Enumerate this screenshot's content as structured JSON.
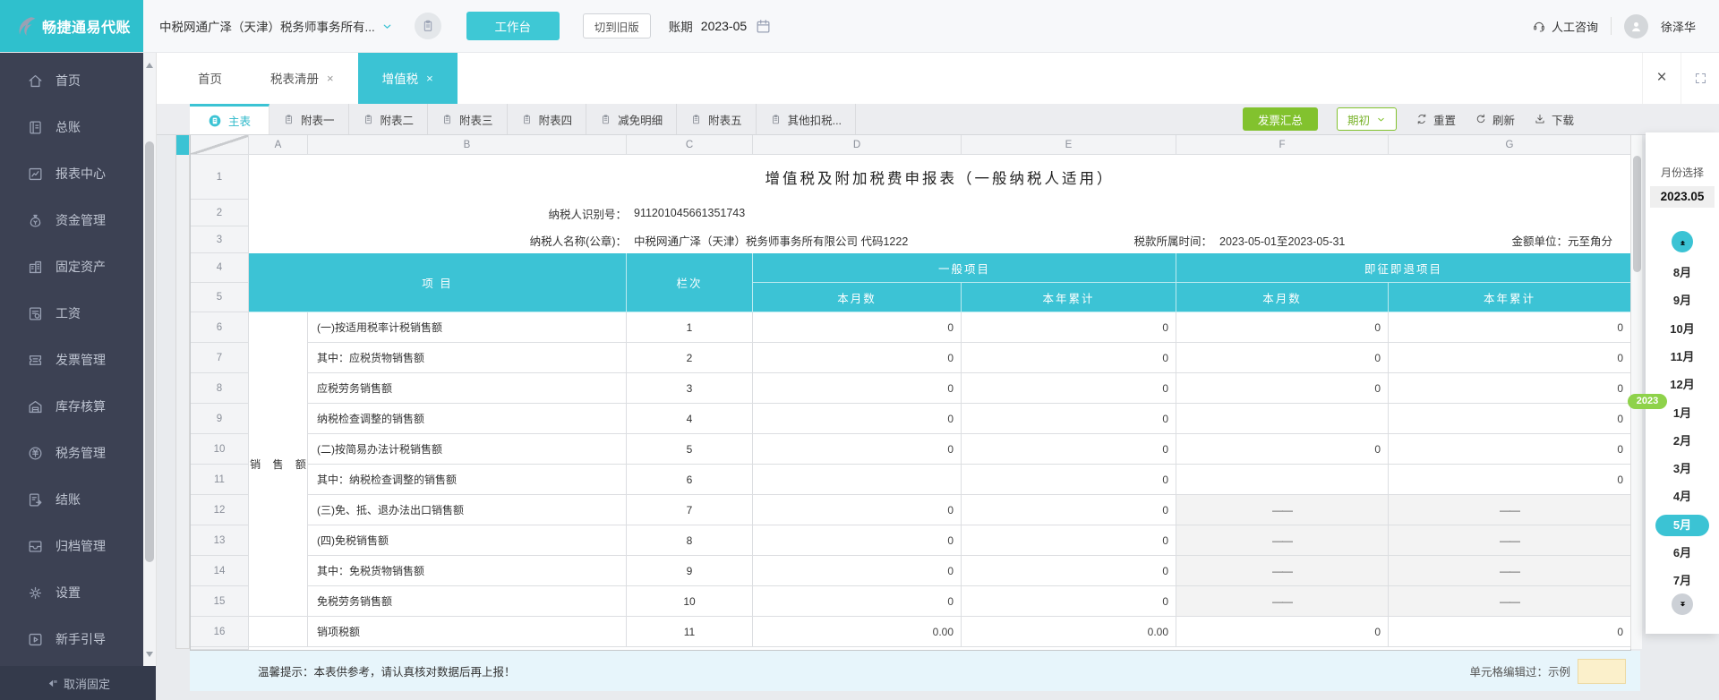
{
  "colors": {
    "teal": "#3bc3d4",
    "green": "#82c22e",
    "table_header": "#3cc3d5",
    "sidebar_bg": "#3c4153",
    "year_badge": "#8ed24a",
    "edited_cell": "#fbf0cb"
  },
  "brand": {
    "name": "畅捷通易代账"
  },
  "header": {
    "company": "中税网通广泽（天津）税务师事务所有...",
    "workbench": "工作台",
    "switch_old": "切到旧版",
    "period_label": "账期",
    "period_value": "2023-05",
    "support": "人工咨询",
    "user": "徐泽华"
  },
  "sidebar": {
    "items": [
      {
        "id": "home",
        "label": "首页"
      },
      {
        "id": "ledger",
        "label": "总账"
      },
      {
        "id": "report",
        "label": "报表中心"
      },
      {
        "id": "funds",
        "label": "资金管理"
      },
      {
        "id": "assets",
        "label": "固定资产"
      },
      {
        "id": "salary",
        "label": "工资"
      },
      {
        "id": "invoice",
        "label": "发票管理"
      },
      {
        "id": "inventory",
        "label": "库存核算"
      },
      {
        "id": "tax",
        "label": "税务管理"
      },
      {
        "id": "closing",
        "label": "结账"
      },
      {
        "id": "archive",
        "label": "归档管理"
      },
      {
        "id": "settings",
        "label": "设置"
      },
      {
        "id": "guide",
        "label": "新手引导"
      }
    ],
    "unpin": "取消固定"
  },
  "tabs": [
    {
      "label": "首页",
      "closable": false,
      "active": false
    },
    {
      "label": "税表清册",
      "closable": true,
      "active": false
    },
    {
      "label": "增值税",
      "closable": true,
      "active": true
    }
  ],
  "subtabs": [
    "主表",
    "附表一",
    "附表二",
    "附表三",
    "附表四",
    "减免明细",
    "附表五",
    "其他扣税..."
  ],
  "toolbar": {
    "invoice_summary": "发票汇总",
    "period_begin": "期初",
    "reset": "重置",
    "refresh": "刷新",
    "download": "下载"
  },
  "sheet": {
    "col_letters": [
      "A",
      "B",
      "C",
      "D",
      "E",
      "F",
      "G"
    ],
    "title": "增值税及附加税费申报表（一般纳税人适用）",
    "taxpayer_id_label": "纳税人识别号：",
    "taxpayer_id": "911201045661351743",
    "taxpayer_name_label": "纳税人名称(公章)：",
    "taxpayer_name": "中税网通广泽（天津）税务师事务所有限公司 代码1222",
    "tax_period_label": "税款所属时间：",
    "tax_period": "2023-05-01至2023-05-31",
    "unit_label": "金额单位：元至角分",
    "head": {
      "item": "项 目",
      "column": "栏次",
      "general": "一般项目",
      "refund": "即征即退项目",
      "month": "本月数",
      "ytd": "本年累计"
    },
    "group_label": "销 售 额",
    "rows": [
      {
        "no": "6",
        "label": "(一)按适用税率计税销售额",
        "col": "1",
        "vals": [
          "0",
          "0",
          "0",
          "0"
        ]
      },
      {
        "no": "7",
        "label": "其中：应税货物销售额",
        "col": "2",
        "vals": [
          "0",
          "0",
          "0",
          "0"
        ]
      },
      {
        "no": "8",
        "label": "应税劳务销售额",
        "col": "3",
        "vals": [
          "0",
          "0",
          "0",
          "0"
        ]
      },
      {
        "no": "9",
        "label": "纳税检查调整的销售额",
        "col": "4",
        "vals": [
          "0",
          "0",
          "",
          "0"
        ]
      },
      {
        "no": "10",
        "label": "(二)按简易办法计税销售额",
        "col": "5",
        "vals": [
          "0",
          "0",
          "0",
          "0"
        ]
      },
      {
        "no": "11",
        "label": "其中：纳税检查调整的销售额",
        "col": "6",
        "vals": [
          "",
          "0",
          "",
          "0"
        ]
      },
      {
        "no": "12",
        "label": "(三)免、抵、退办法出口销售额",
        "col": "7",
        "vals": [
          "0",
          "0",
          "——",
          "——"
        ]
      },
      {
        "no": "13",
        "label": "(四)免税销售额",
        "col": "8",
        "vals": [
          "0",
          "0",
          "——",
          "——"
        ]
      },
      {
        "no": "14",
        "label": "其中：免税货物销售额",
        "col": "9",
        "vals": [
          "0",
          "0",
          "——",
          "——"
        ]
      },
      {
        "no": "15",
        "label": "免税劳务销售额",
        "col": "10",
        "vals": [
          "0",
          "0",
          "——",
          "——"
        ]
      },
      {
        "no": "16",
        "label": "销项税额",
        "col": "11",
        "vals": [
          "0.00",
          "0.00",
          "0",
          "0"
        ]
      }
    ]
  },
  "footer": {
    "tip": "温馨提示：本表供参考，请认真核对数据后再上报！",
    "edited_label": "单元格编辑过：示例"
  },
  "month_panel": {
    "title": "月份选择",
    "current": "2023.05",
    "year_badge": "2023",
    "months": [
      "8月",
      "9月",
      "10月",
      "11月",
      "12月",
      "1月",
      "2月",
      "3月",
      "4月",
      "5月",
      "6月",
      "7月"
    ],
    "active": "5月"
  }
}
